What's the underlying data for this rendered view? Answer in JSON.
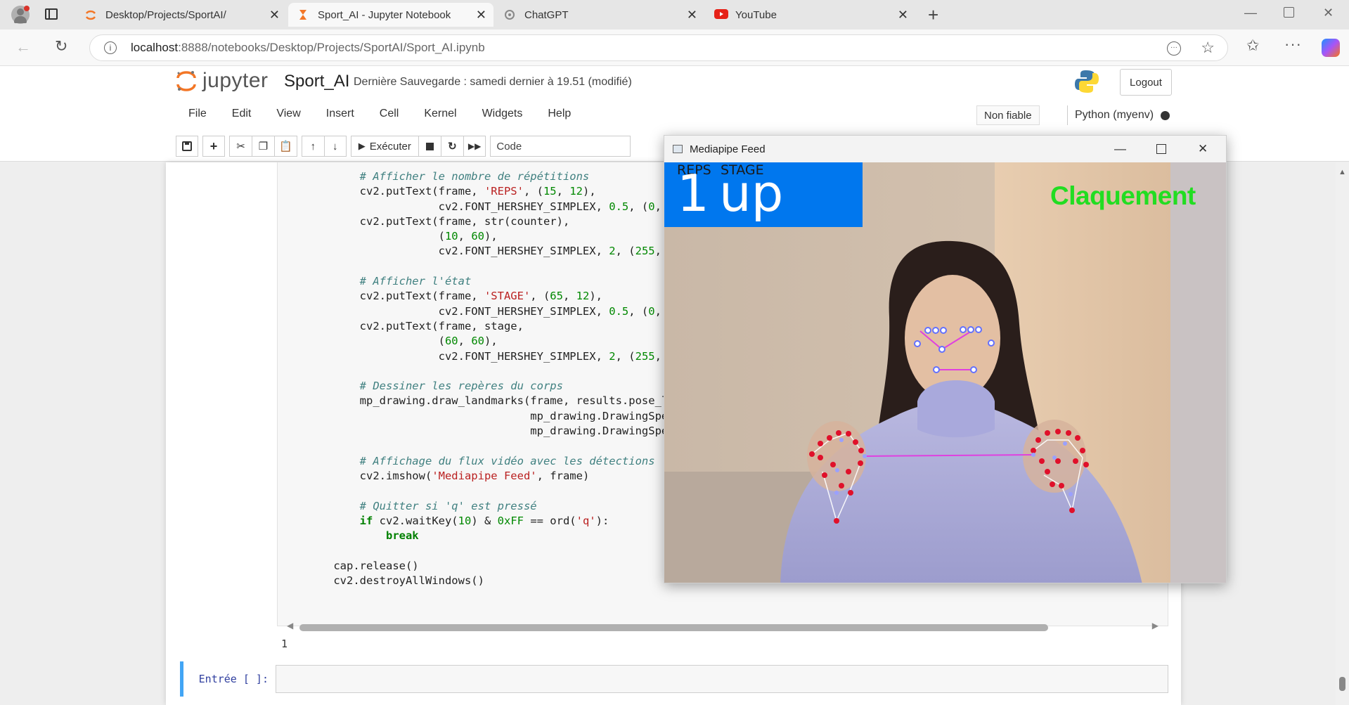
{
  "browser": {
    "tabs": [
      {
        "title": "Desktop/Projects/SportAI/",
        "favicon": "jupyter-spinner-icon"
      },
      {
        "title": "Sport_AI - Jupyter Notebook",
        "favicon": "hourglass-icon"
      },
      {
        "title": "ChatGPT",
        "favicon": "chatgpt-icon"
      },
      {
        "title": "YouTube",
        "favicon": "youtube-icon"
      }
    ],
    "url_host": "localhost",
    "url_rest": ":8888/notebooks/Desktop/Projects/SportAI/Sport_AI.ipynb"
  },
  "jupyter": {
    "logo_text": "jupyter",
    "notebook_name": "Sport_AI",
    "save_info": "Dernière Sauvegarde : samedi dernier à 19.51   (modifié)",
    "logout_label": "Logout",
    "menu": [
      "File",
      "Edit",
      "View",
      "Insert",
      "Cell",
      "Kernel",
      "Widgets",
      "Help"
    ],
    "trust_label": "Non fiable",
    "kernel_label": "Python (myenv)",
    "run_label": "Exécuter",
    "cell_type": "Code"
  },
  "notebook": {
    "output_line": "1",
    "input_prompt": "Entrée [ ]:"
  },
  "feed_window": {
    "title": "Mediapipe Feed",
    "reps_label": "REPS",
    "stage_label": "STAGE",
    "reps_value": "1",
    "stage_value": "up",
    "status_text": "Claquement"
  },
  "colors": {
    "accent_blue": "#0077ee",
    "status_green": "#22dd22",
    "landmark_red": "#e0102a",
    "connection_magenta": "#e040e0"
  }
}
